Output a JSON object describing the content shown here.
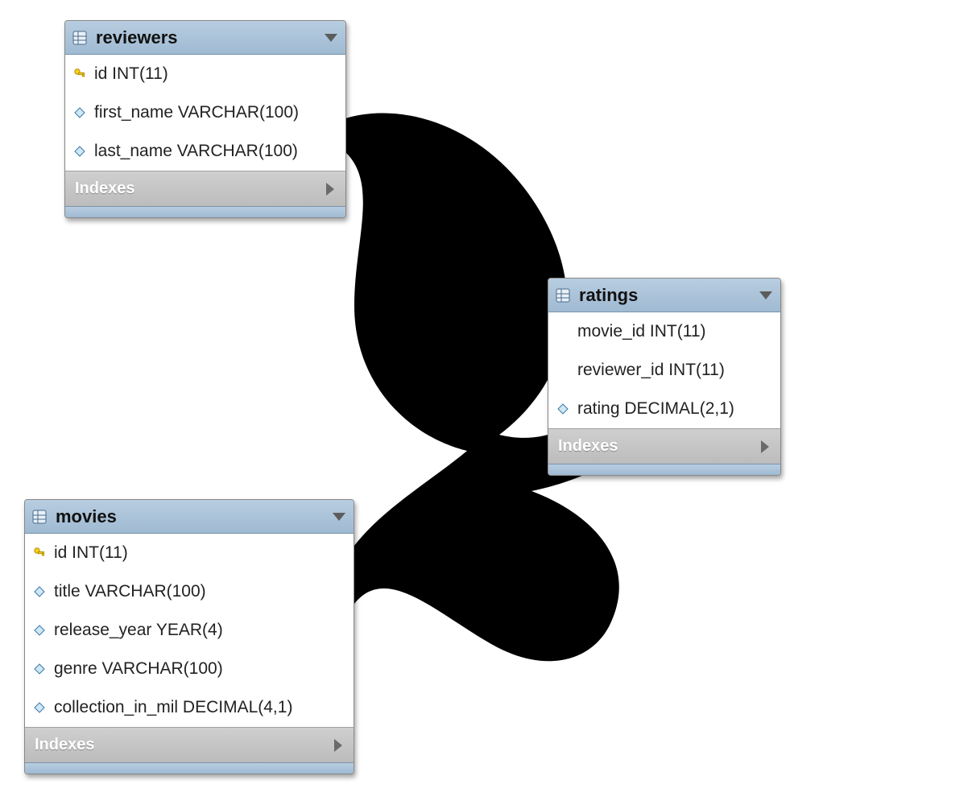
{
  "labels": {
    "indexes": "Indexes"
  },
  "colors": {
    "header_bg_top": "#b8cde0",
    "header_bg_bottom": "#9fbad2",
    "index_bg_top": "#cfcfcf",
    "index_bg_bottom": "#bcbcbc",
    "connector": "#000000"
  },
  "tables": {
    "reviewers": {
      "name": "reviewers",
      "columns": [
        {
          "name": "id INT(11)",
          "icon": "key"
        },
        {
          "name": "first_name VARCHAR(100)",
          "icon": "diamond"
        },
        {
          "name": "last_name VARCHAR(100)",
          "icon": "diamond"
        }
      ]
    },
    "movies": {
      "name": "movies",
      "columns": [
        {
          "name": "id INT(11)",
          "icon": "key"
        },
        {
          "name": "title VARCHAR(100)",
          "icon": "diamond"
        },
        {
          "name": "release_year YEAR(4)",
          "icon": "diamond"
        },
        {
          "name": "genre VARCHAR(100)",
          "icon": "diamond"
        },
        {
          "name": "collection_in_mil DECIMAL(4,1)",
          "icon": "diamond"
        }
      ]
    },
    "ratings": {
      "name": "ratings",
      "columns": [
        {
          "name": "movie_id INT(11)",
          "icon": "none"
        },
        {
          "name": "reviewer_id INT(11)",
          "icon": "none"
        },
        {
          "name": "rating DECIMAL(2,1)",
          "icon": "diamond"
        }
      ]
    }
  },
  "relationships": [
    {
      "from_table": "reviewers",
      "from_column": "id",
      "to_table": "ratings",
      "to_column": "reviewer_id"
    },
    {
      "from_table": "movies",
      "from_column": "id",
      "to_table": "ratings",
      "to_column": "movie_id"
    }
  ]
}
